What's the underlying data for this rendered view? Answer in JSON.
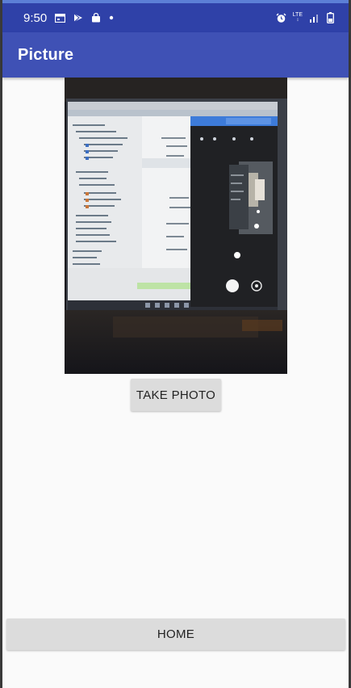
{
  "status_bar": {
    "time": "9:50",
    "left_icons": [
      "calendar-icon",
      "play-store-icon",
      "bag-icon",
      "dot-icon"
    ],
    "right_icons": [
      "alarm-icon",
      "lte-icon",
      "signal-icon",
      "battery-icon"
    ],
    "lte_label": "LTE",
    "background": "#2f41a8"
  },
  "app_bar": {
    "title": "Picture",
    "background": "#3f51b5"
  },
  "photo": {
    "alt": "Captured photo of a computer screen showing a phone camera emulator"
  },
  "buttons": {
    "take_photo": "TAKE PHOTO",
    "home": "HOME"
  }
}
